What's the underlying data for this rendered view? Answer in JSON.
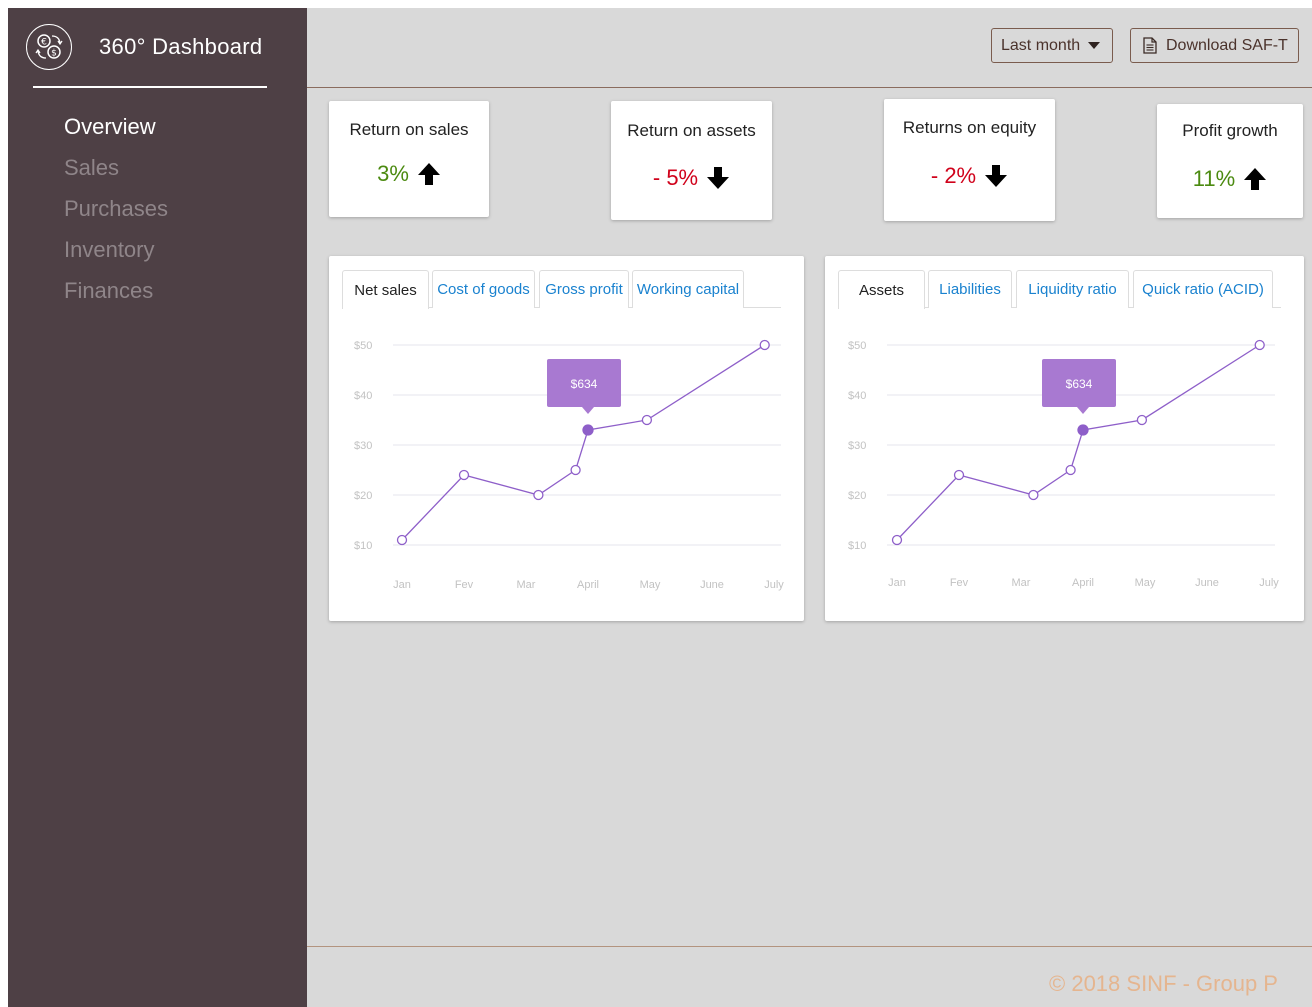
{
  "sidebar": {
    "title": "360° Dashboard",
    "logo_icon": "currency-exchange-icon",
    "items": [
      {
        "label": "Overview",
        "active": true
      },
      {
        "label": "Sales",
        "active": false
      },
      {
        "label": "Purchases",
        "active": false
      },
      {
        "label": "Inventory",
        "active": false
      },
      {
        "label": "Finances",
        "active": false
      }
    ]
  },
  "toolbar": {
    "period_label": "Last month",
    "download_label": "Download SAF-T",
    "download_icon": "document-icon"
  },
  "kpis": [
    {
      "title": "Return on sales",
      "value": "3%",
      "trend": "up",
      "color": "#4b8a10"
    },
    {
      "title": "Return on assets",
      "value": "- 5%",
      "trend": "down",
      "color": "#d0021b"
    },
    {
      "title": "Returns on equity",
      "value": "- 2%",
      "trend": "down",
      "color": "#d0021b"
    },
    {
      "title": "Profit growth",
      "value": "11%",
      "trend": "up",
      "color": "#4b8a10"
    }
  ],
  "cards": [
    {
      "tabs": [
        "Net sales",
        "Cost of goods",
        "Gross profit",
        "Working capital"
      ],
      "active_tab": 0
    },
    {
      "tabs": [
        "Assets",
        "Liabilities",
        "Liquidity ratio",
        "Quick ratio (ACID)"
      ],
      "active_tab": 0
    }
  ],
  "chart_data": [
    {
      "type": "line",
      "x_tick_labels": [
        "Jan",
        "Fev",
        "Mar",
        "April",
        "May",
        "June",
        "July"
      ],
      "y_tick_labels": [
        "$10",
        "$20",
        "$30",
        "$40",
        "$50"
      ],
      "y_ticks": [
        10,
        20,
        30,
        40,
        50
      ],
      "x": [
        1.0,
        2.0,
        3.2,
        3.8,
        4.0,
        4.95,
        6.85
      ],
      "y": [
        11,
        24,
        20,
        25,
        33,
        35,
        50
      ],
      "highlight_index": 4,
      "tooltip": "$634",
      "grid": true,
      "color": "#8e5fc9"
    },
    {
      "type": "line",
      "x_tick_labels": [
        "Jan",
        "Fev",
        "Mar",
        "April",
        "May",
        "June",
        "July"
      ],
      "y_tick_labels": [
        "$10",
        "$20",
        "$30",
        "$40",
        "$50"
      ],
      "y_ticks": [
        10,
        20,
        30,
        40,
        50
      ],
      "x": [
        1.0,
        2.0,
        3.2,
        3.8,
        4.0,
        4.95,
        6.85
      ],
      "y": [
        11,
        24,
        20,
        25,
        33,
        35,
        50
      ],
      "highlight_index": 4,
      "tooltip": "$634",
      "grid": true,
      "color": "#8e5fc9"
    }
  ],
  "footer": {
    "text": "© 2018 SINF - Group P"
  }
}
